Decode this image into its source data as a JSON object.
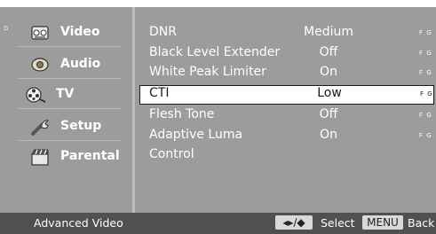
{
  "sidebar": {
    "marker": "G",
    "items": [
      {
        "label": "Video",
        "icon": "video-tape-icon"
      },
      {
        "label": "Audio",
        "icon": "speaker-icon"
      },
      {
        "label": "TV",
        "icon": "film-reel-icon"
      },
      {
        "label": "Setup",
        "icon": "wrench-icon"
      },
      {
        "label": "Parental",
        "icon": "clapperboard-icon"
      }
    ]
  },
  "settings": {
    "rows": [
      {
        "label": "DNR",
        "value": "Medium",
        "code": "F G"
      },
      {
        "label": "Black Level Extender",
        "value": "Off",
        "code": "F G"
      },
      {
        "label": "White Peak Limiter",
        "value": "On",
        "code": "F G"
      },
      {
        "label": "CTI",
        "value": "Low",
        "code": "F G",
        "selected": true
      },
      {
        "label": "Flesh Tone",
        "value": "Off",
        "code": "F G"
      },
      {
        "label": "Adaptive Luma",
        "value": "On",
        "code": "F G"
      },
      {
        "label": "Control",
        "value": "",
        "code": ""
      }
    ]
  },
  "footer": {
    "title": "Advanced Video",
    "nav_key": "◂▸/◆",
    "select_label": "Select",
    "menu_key": "MENU",
    "back_label": "Back"
  },
  "colors": {
    "panel": "#9c9c9c",
    "footer": "#505050",
    "selected_bg": "#ffffff",
    "text": "#ffffff"
  }
}
